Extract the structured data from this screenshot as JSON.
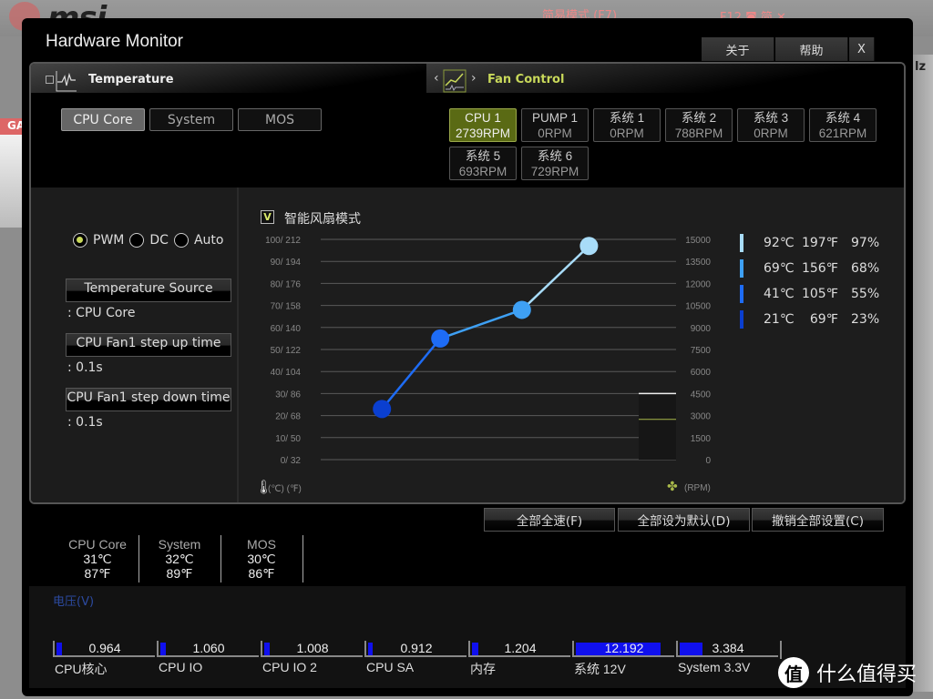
{
  "background": {
    "brand": "msi",
    "mode_label": "简易模式 (F7)",
    "top_icons_text": "F12   ◙  简   ✕",
    "side_tab": "GA",
    "right_edge": "lz"
  },
  "window": {
    "title": "Hardware Monitor",
    "buttons": {
      "about": "关于",
      "help": "帮助",
      "close": "X"
    }
  },
  "tabs": {
    "temperature": "Temperature",
    "fan_control": "Fan Control",
    "prev": "‹",
    "next": "›"
  },
  "temp_sources": [
    {
      "label": "CPU Core",
      "active": true
    },
    {
      "label": "System",
      "active": false
    },
    {
      "label": "MOS",
      "active": false
    }
  ],
  "fans": [
    {
      "name": "CPU 1",
      "rpm": "2739RPM",
      "active": true
    },
    {
      "name": "PUMP 1",
      "rpm": "0RPM",
      "active": false
    },
    {
      "name": "系统 1",
      "rpm": "0RPM",
      "active": false
    },
    {
      "name": "系统 2",
      "rpm": "788RPM",
      "active": false
    },
    {
      "name": "系统 3",
      "rpm": "0RPM",
      "active": false
    },
    {
      "name": "系统 4",
      "rpm": "621RPM",
      "active": false
    },
    {
      "name": "系统 5",
      "rpm": "693RPM",
      "active": false
    },
    {
      "name": "系统 6",
      "rpm": "729RPM",
      "active": false
    }
  ],
  "fan_mode": {
    "options": [
      {
        "label": "PWM",
        "selected": true
      },
      {
        "label": "DC",
        "selected": false
      },
      {
        "label": "Auto",
        "selected": false
      }
    ]
  },
  "settings": [
    {
      "button": "Temperature Source",
      "value": ": CPU Core"
    },
    {
      "button": "CPU Fan1 step up time",
      "value": ": 0.1s"
    },
    {
      "button": "CPU Fan1 step down time",
      "value": ": 0.1s"
    }
  ],
  "smart_fan": {
    "checked": true,
    "check_glyph": "V",
    "label": "智能风扇模式"
  },
  "chart_data": {
    "type": "line",
    "title": "Smart Fan Curve",
    "left_axis": {
      "label": "(℃) (℉)",
      "ticks": [
        "100/ 212",
        "90/ 194",
        "80/ 176",
        "70/ 158",
        "60/ 140",
        "50/ 122",
        "40/ 104",
        "30/  86",
        "20/  68",
        "10/  50",
        "0/  32"
      ],
      "range": [
        0,
        100
      ]
    },
    "right_axis": {
      "label": "(RPM)",
      "ticks": [
        "15000",
        "13500",
        "12000",
        "10500",
        "9000",
        "7500",
        "6000",
        "4500",
        "3000",
        "1500",
        "0"
      ],
      "range": [
        0,
        15000
      ]
    },
    "grid": true,
    "points": [
      {
        "temp_c": 21,
        "temp_f": 69,
        "percent": 23,
        "color": "#0a3fd0"
      },
      {
        "temp_c": 41,
        "temp_f": 105,
        "percent": 55,
        "color": "#1e6cf5"
      },
      {
        "temp_c": 69,
        "temp_f": 156,
        "percent": 68,
        "color": "#3ea0f4"
      },
      {
        "temp_c": 92,
        "temp_f": 197,
        "percent": 97,
        "color": "#a8dcf8"
      }
    ],
    "current_rpm": 2739,
    "current_gauge_max_rpm": 4500
  },
  "legend": [
    {
      "c": "92℃",
      "f": "197℉",
      "p": "97%",
      "color": "#a8dcf8"
    },
    {
      "c": "69℃",
      "f": "156℉",
      "p": "68%",
      "color": "#3ea0f4"
    },
    {
      "c": "41℃",
      "f": "105℉",
      "p": "55%",
      "color": "#1e6cf5"
    },
    {
      "c": "21℃",
      "f": "69℉",
      "p": "23%",
      "color": "#0a3fd0"
    }
  ],
  "actions": {
    "full_speed": "全部全速(F)",
    "set_default": "全部设为默认(D)",
    "cancel_all": "撤销全部设置(C)"
  },
  "temperatures": [
    {
      "name": "CPU Core",
      "c": "31℃",
      "f": "87℉"
    },
    {
      "name": "System",
      "c": "32℃",
      "f": "89℉"
    },
    {
      "name": "MOS",
      "c": "30℃",
      "f": "86℉"
    }
  ],
  "voltage": {
    "title": "电压(V)",
    "items": [
      {
        "label": "CPU核心",
        "value": "0.964",
        "fill": 0.06
      },
      {
        "label": "CPU IO",
        "value": "1.060",
        "fill": 0.06
      },
      {
        "label": "CPU IO 2",
        "value": "1.008",
        "fill": 0.06
      },
      {
        "label": "CPU SA",
        "value": "0.912",
        "fill": 0.05
      },
      {
        "label": "内存",
        "value": "1.204",
        "fill": 0.07
      },
      {
        "label": "系统 12V",
        "value": "12.192",
        "fill": 0.88
      },
      {
        "label": "System 3.3V",
        "value": "3.384",
        "fill": 0.24
      }
    ]
  },
  "watermark": {
    "logo": "值",
    "text": "什么值得买"
  }
}
